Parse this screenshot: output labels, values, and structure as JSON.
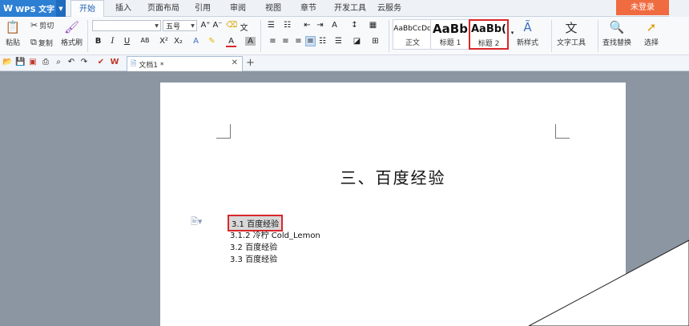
{
  "app": {
    "brand": "WPS 文字",
    "login": "未登录"
  },
  "menu_tabs": [
    "开始",
    "插入",
    "页面布局",
    "引用",
    "审阅",
    "视图",
    "章节",
    "开发工具",
    "云服务"
  ],
  "ribbon": {
    "paste": "粘贴",
    "cut": "剪切",
    "copy": "复制",
    "format_painter": "格式刷",
    "font_size": "五号",
    "styles": [
      {
        "preview": "AaBbCcDd",
        "name": "正文"
      },
      {
        "preview": "AaBb",
        "name": "标题 1"
      },
      {
        "preview": "AaBb(",
        "name": "标题 2"
      }
    ],
    "new_style": "新样式",
    "text_tools": "文字工具",
    "find_replace": "查找替换",
    "select": "选择"
  },
  "doc_tab": {
    "title": "文档1 *"
  },
  "document": {
    "heading": "三、百度经验",
    "lines": [
      "3.1 百度经验",
      "3.1.2 冷柠 Cold_Lemon",
      "3.2 百度经验",
      "3.3 百度经验"
    ]
  },
  "colors": {
    "accent": "#2d7fd3",
    "login": "#f06b3f",
    "highlight_border": "#d8282b"
  }
}
